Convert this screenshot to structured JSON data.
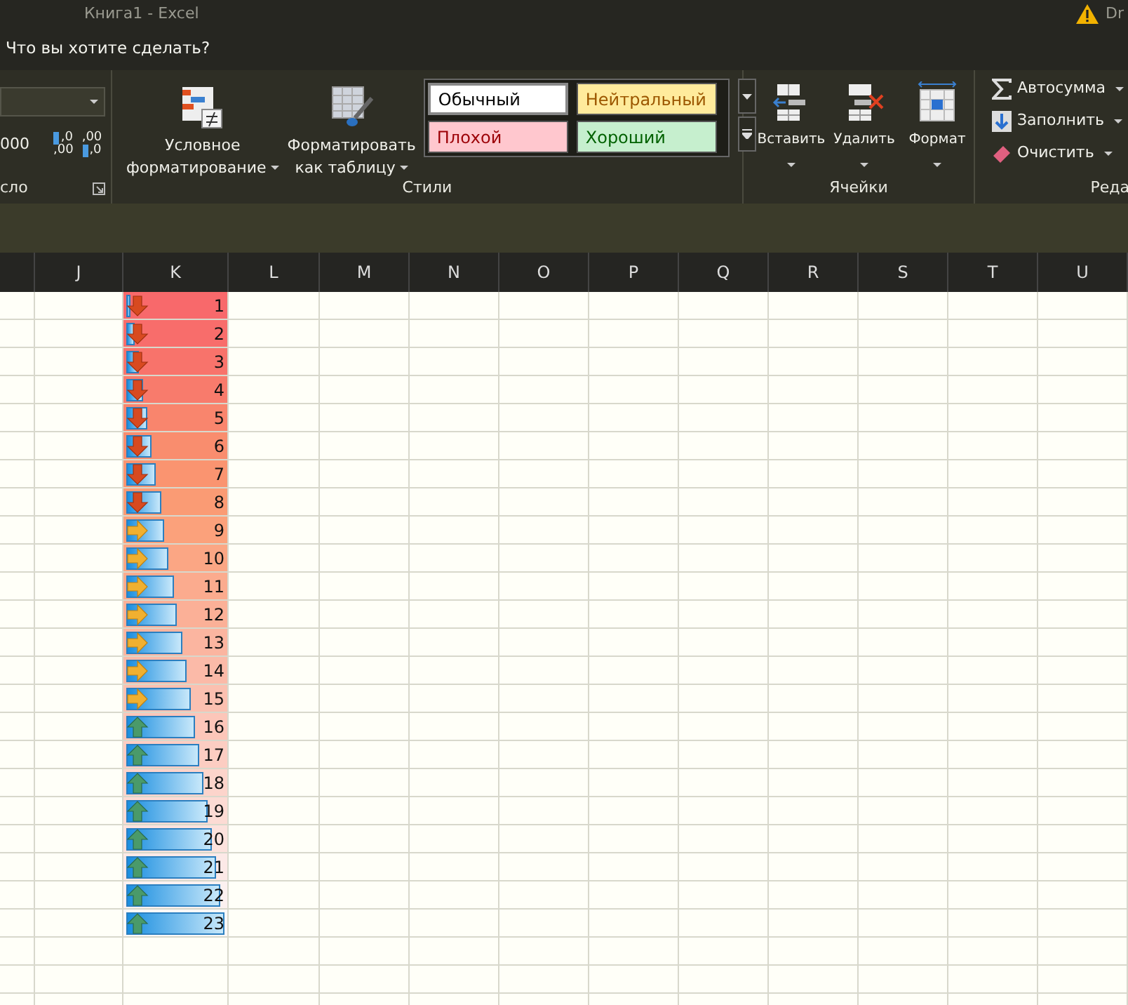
{
  "window": {
    "title": "Книга1 - Excel",
    "account": "Dr"
  },
  "tell_me": {
    "placeholder": "Что вы хотите сделать?"
  },
  "number_group": {
    "label": "сло",
    "thousands": "000",
    "decimal_buttons": [
      {
        "top": ",0",
        "bottom": ",00",
        "kind": "increase"
      },
      {
        "top": ",00",
        "bottom": ",0",
        "kind": "decrease"
      }
    ]
  },
  "styles_group": {
    "label": "Стили",
    "buttons": [
      {
        "lines": [
          "Условное",
          "форматирование"
        ],
        "kind": "conditional"
      },
      {
        "lines": [
          "Форматировать",
          "как таблицу"
        ],
        "kind": "table"
      }
    ],
    "gallery": [
      {
        "label": "Обычный",
        "color": "#ffffff",
        "selected": true
      },
      {
        "label": "Нейтральный",
        "color": "#ffeb9c",
        "selected": false
      },
      {
        "label": "Плохой",
        "color": "#ffc7ce",
        "selected": false
      },
      {
        "label": "Хороший",
        "color": "#c6efce",
        "selected": false
      }
    ]
  },
  "cells_group": {
    "label": "Ячейки",
    "buttons": [
      {
        "label": "Вставить",
        "kind": "insert"
      },
      {
        "label": "Удалить",
        "kind": "delete"
      },
      {
        "label": "Формат",
        "kind": "format"
      }
    ]
  },
  "editing_group": {
    "label": "Реда",
    "buttons": [
      {
        "label": "Автосумма",
        "kind": "autosum"
      },
      {
        "label": "Заполнить",
        "kind": "fill"
      },
      {
        "label": "Очистить",
        "kind": "clear"
      }
    ]
  },
  "sheet": {
    "columns": [
      "J",
      "K",
      "L",
      "M",
      "N",
      "O",
      "P",
      "Q",
      "R",
      "S",
      "T",
      "U"
    ],
    "cells": [
      {
        "value": "1",
        "kind": "down",
        "level": 0.04,
        "color": "#f8696b"
      },
      {
        "value": "2",
        "kind": "down",
        "level": 0.09,
        "color": "#f86d6b"
      },
      {
        "value": "3",
        "kind": "down",
        "level": 0.13,
        "color": "#f8736b"
      },
      {
        "value": "4",
        "kind": "down",
        "level": 0.17,
        "color": "#f87b6c"
      },
      {
        "value": "5",
        "kind": "down",
        "level": 0.22,
        "color": "#f9856d"
      },
      {
        "value": "6",
        "kind": "down",
        "level": 0.26,
        "color": "#f98d6e"
      },
      {
        "value": "7",
        "kind": "down",
        "level": 0.3,
        "color": "#fa9470"
      },
      {
        "value": "8",
        "kind": "down",
        "level": 0.35,
        "color": "#fa9b74"
      },
      {
        "value": "9",
        "kind": "right",
        "level": 0.39,
        "color": "#fba17b"
      },
      {
        "value": "10",
        "kind": "right",
        "level": 0.43,
        "color": "#fba684"
      },
      {
        "value": "11",
        "kind": "right",
        "level": 0.48,
        "color": "#fbab8e"
      },
      {
        "value": "12",
        "kind": "right",
        "level": 0.52,
        "color": "#fbb097"
      },
      {
        "value": "13",
        "kind": "right",
        "level": 0.57,
        "color": "#fbb5a0"
      },
      {
        "value": "14",
        "kind": "right",
        "level": 0.61,
        "color": "#fbbaa8"
      },
      {
        "value": "15",
        "kind": "right",
        "level": 0.65,
        "color": "#fbc0b0"
      },
      {
        "value": "16",
        "kind": "up",
        "level": 0.7,
        "color": "#fcc6b9"
      },
      {
        "value": "17",
        "kind": "up",
        "level": 0.74,
        "color": "#fccdc2"
      },
      {
        "value": "18",
        "kind": "up",
        "level": 0.78,
        "color": "#fcd4cb"
      },
      {
        "value": "19",
        "kind": "up",
        "level": 0.83,
        "color": "#fcdbd4"
      },
      {
        "value": "20",
        "kind": "up",
        "level": 0.87,
        "color": "#fce2dd"
      },
      {
        "value": "21",
        "kind": "up",
        "level": 0.91,
        "color": "#fce9e7"
      },
      {
        "value": "22",
        "kind": "up",
        "level": 0.96,
        "color": "#fcf1f0"
      },
      {
        "value": "23",
        "kind": "up",
        "level": 1,
        "color": "#fcf8f8"
      }
    ]
  }
}
